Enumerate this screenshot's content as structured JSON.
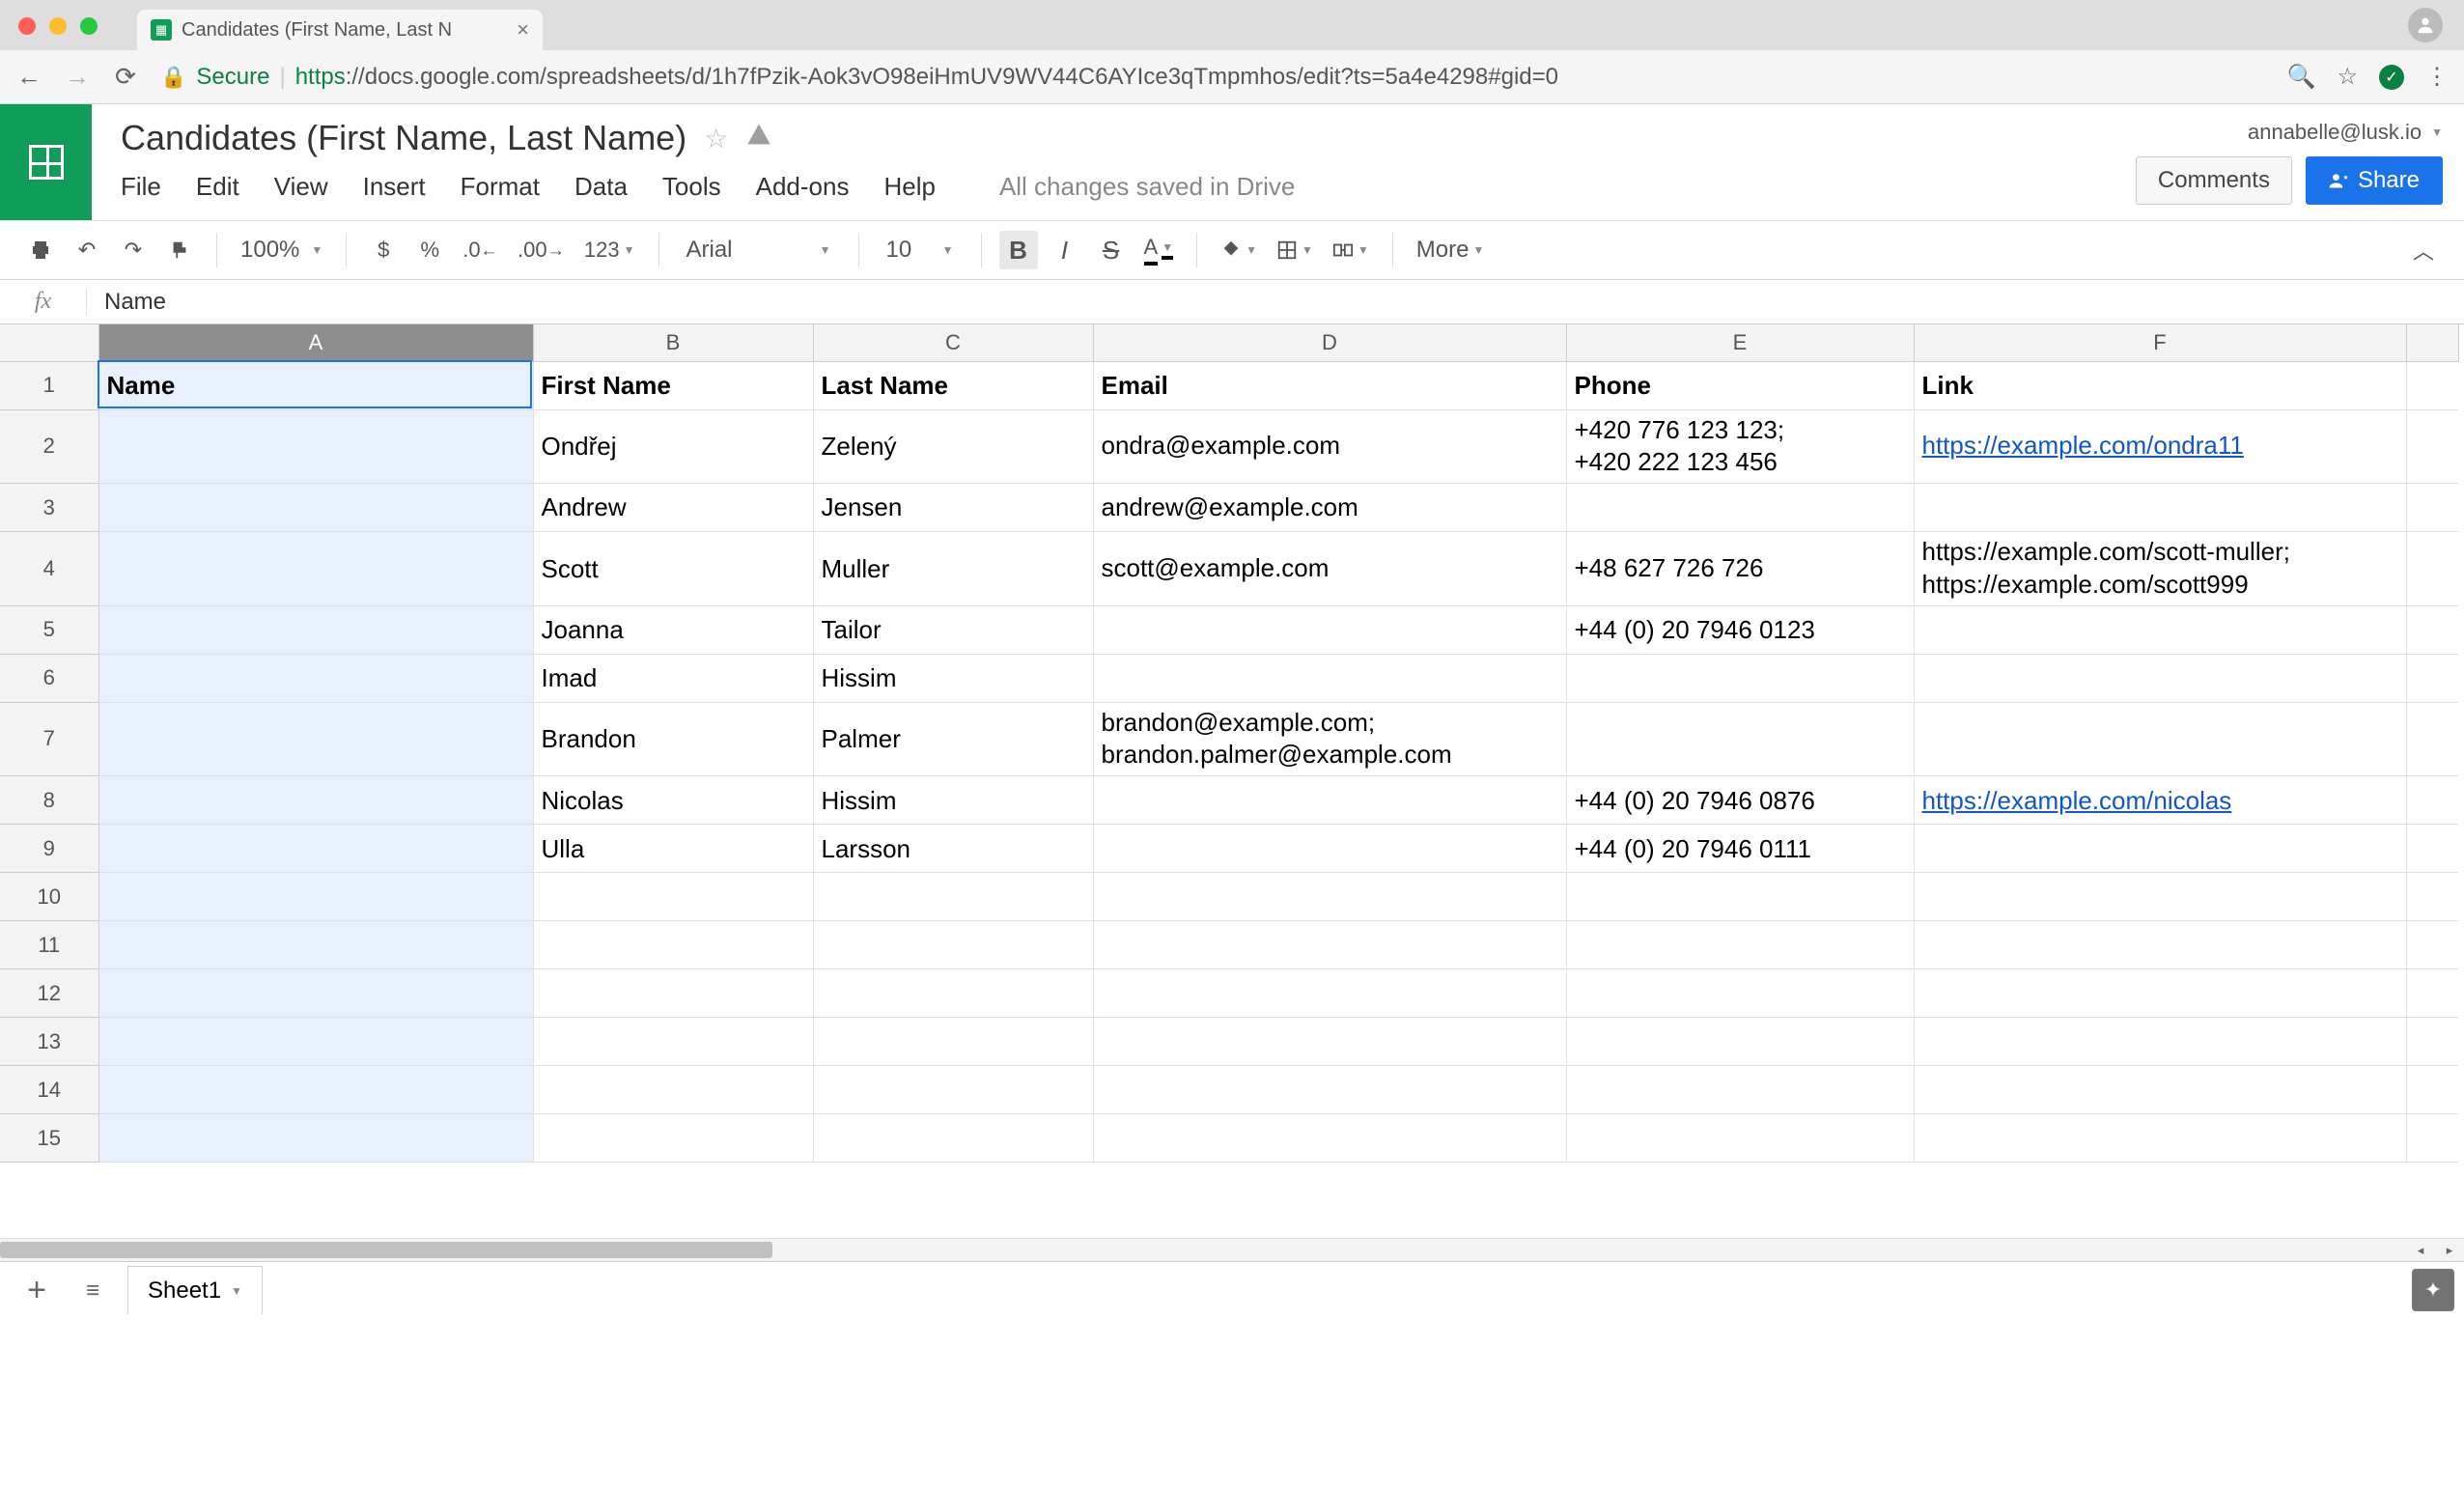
{
  "browser": {
    "tab_title": "Candidates (First Name, Last N",
    "url_secure": "Secure",
    "url_host": "https",
    "url_rest": "://docs.google.com/spreadsheets/d/1h7fPzik-Aok3vO98eiHmUV9WV44C6AYIce3qTmpmhos/edit?ts=5a4e4298#gid=0"
  },
  "doc": {
    "title": "Candidates (First Name, Last Name)",
    "user_email": "annabelle@lusk.io",
    "comments_label": "Comments",
    "share_label": "Share",
    "save_status": "All changes saved in Drive"
  },
  "menu": {
    "file": "File",
    "edit": "Edit",
    "view": "View",
    "insert": "Insert",
    "format": "Format",
    "data": "Data",
    "tools": "Tools",
    "addons": "Add-ons",
    "help": "Help"
  },
  "toolbar": {
    "zoom": "100%",
    "font": "Arial",
    "font_size": "10",
    "more": "More",
    "number_fmt": "123",
    "currency": "$",
    "percent": "%"
  },
  "formula": {
    "fx": "fx",
    "value": "Name"
  },
  "columns": [
    "A",
    "B",
    "C",
    "D",
    "E",
    "F"
  ],
  "headers": {
    "A": "Name",
    "B": "First Name",
    "C": "Last Name",
    "D": "Email",
    "E": "Phone",
    "F": "Link"
  },
  "rows": [
    {
      "B": "Ondřej",
      "C": "Zelený",
      "D": "ondra@example.com",
      "E": "+420 776 123 123;\n+420 222 123 456",
      "F": "https://example.com/ondra11",
      "F_link": true,
      "multi": true
    },
    {
      "B": "Andrew",
      "C": "Jensen",
      "D": "andrew@example.com",
      "E": "",
      "F": ""
    },
    {
      "B": "Scott",
      "C": "Muller",
      "D": "scott@example.com",
      "E": "+48 627 726 726",
      "F": "https://example.com/scott-muller;\nhttps://example.com/scott999",
      "multi": true
    },
    {
      "B": "Joanna",
      "C": "Tailor",
      "D": "",
      "E": "+44 (0) 20 7946 0123",
      "F": ""
    },
    {
      "B": "Imad",
      "C": "Hissim",
      "D": "",
      "E": "",
      "F": ""
    },
    {
      "B": "Brandon",
      "C": "Palmer",
      "D": "brandon@example.com;\nbrandon.palmer@example.com",
      "E": "",
      "F": "",
      "multi": true
    },
    {
      "B": "Nicolas",
      "C": "Hissim",
      "D": "",
      "E": "+44 (0) 20 7946 0876",
      "F": "https://example.com/nicolas",
      "F_link": true
    },
    {
      "B": "Ulla",
      "C": "Larsson",
      "D": "",
      "E": "+44 (0) 20 7946 0111",
      "F": ""
    }
  ],
  "sheet_tab": "Sheet1"
}
